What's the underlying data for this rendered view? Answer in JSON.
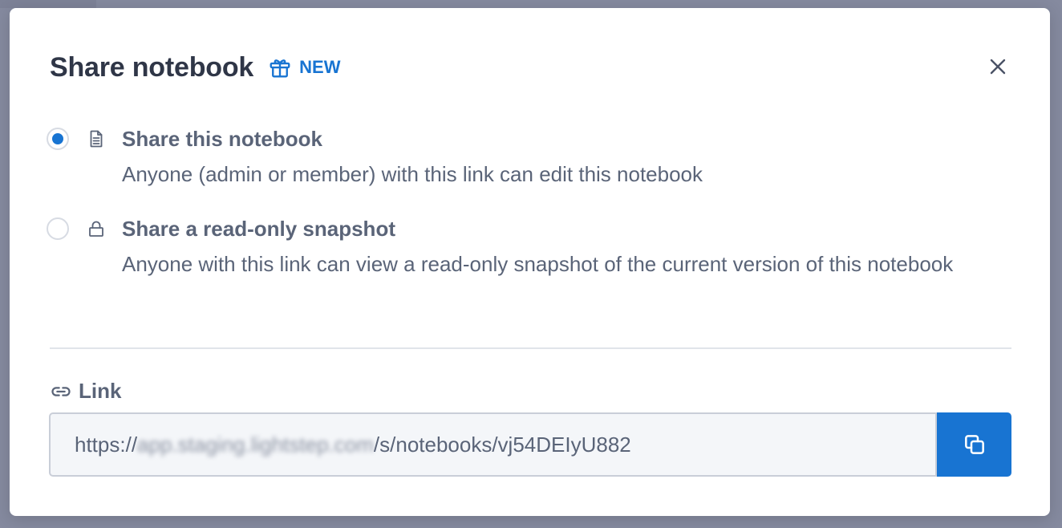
{
  "modal": {
    "title": "Share notebook",
    "badge": "NEW",
    "options": [
      {
        "title": "Share this notebook",
        "description": "Anyone (admin or member) with this link can edit this notebook",
        "selected": true,
        "icon": "document-icon"
      },
      {
        "title": "Share a read-only snapshot",
        "description": "Anyone with this link can view a read-only snapshot of the current version of this notebook",
        "selected": false,
        "icon": "lock-icon"
      }
    ],
    "link": {
      "label": "Link",
      "prefix": "https://",
      "blurred_host": "app.staging.lightstep.com",
      "path": "/s/notebooks/vj54DEIyU882"
    }
  },
  "colors": {
    "accent": "#1874d2",
    "title": "#2f3647",
    "text": "#5a6478"
  }
}
